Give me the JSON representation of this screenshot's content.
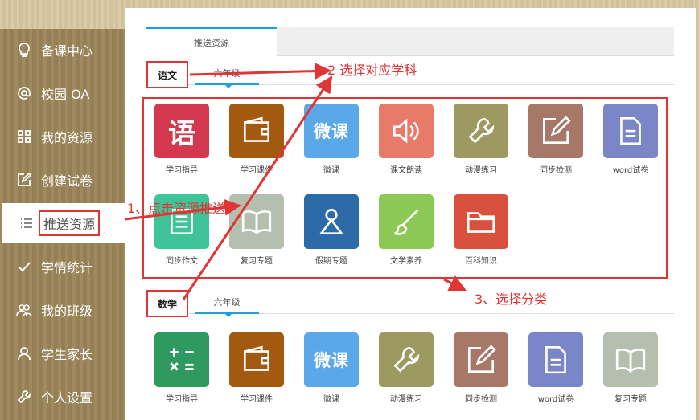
{
  "sidebar": {
    "items": [
      {
        "label": "备课中心",
        "icon": "lightbulb-icon"
      },
      {
        "label": "校园 OA",
        "icon": "at-icon"
      },
      {
        "label": "我的资源",
        "icon": "grid-icon"
      },
      {
        "label": "创建试卷",
        "icon": "edit-square-icon"
      },
      {
        "label": "推送资源",
        "icon": "list-icon"
      },
      {
        "label": "学情统计",
        "icon": "check-icon"
      },
      {
        "label": "我的班级",
        "icon": "users-icon"
      },
      {
        "label": "学生家长",
        "icon": "user-icon"
      },
      {
        "label": "个人设置",
        "icon": "wrench-icon"
      }
    ]
  },
  "main": {
    "tab_label": "推送资源",
    "sections": [
      {
        "subject": "语文",
        "grade": "六年级",
        "resources": [
          {
            "label": "学习指导",
            "icon": "yu-char-icon",
            "color": "#d4384f"
          },
          {
            "label": "学习课件",
            "icon": "wallet-icon",
            "color": "#a3590f"
          },
          {
            "label": "微课",
            "icon": "weike-text-icon",
            "color": "#5aa8e8"
          },
          {
            "label": "课文朗读",
            "icon": "speaker-icon",
            "color": "#e87a6a"
          },
          {
            "label": "动漫练习",
            "icon": "wrench-icon",
            "color": "#9c9a60"
          },
          {
            "label": "同步检测",
            "icon": "edit-icon",
            "color": "#a77868"
          },
          {
            "label": "word试卷",
            "icon": "document-icon",
            "color": "#7a86c8"
          },
          {
            "label": "同步作文",
            "icon": "notepad-icon",
            "color": "#3fc49a"
          },
          {
            "label": "复习专题",
            "icon": "book-icon",
            "color": "#b4bfae"
          },
          {
            "label": "假期专题",
            "icon": "person-icon",
            "color": "#2d6aa8"
          },
          {
            "label": "文学素养",
            "icon": "brush-icon",
            "color": "#8bc855"
          },
          {
            "label": "百科知识",
            "icon": "folder-icon",
            "color": "#d8503e"
          }
        ]
      },
      {
        "subject": "数学",
        "grade": "六年级",
        "resources": [
          {
            "label": "学习指导",
            "icon": "math-symbols-icon",
            "color": "#2f9a5f"
          },
          {
            "label": "学习课件",
            "icon": "wallet-icon",
            "color": "#a3590f"
          },
          {
            "label": "微课",
            "icon": "weike-text-icon",
            "color": "#5aa8e8"
          },
          {
            "label": "动漫练习",
            "icon": "wrench-icon",
            "color": "#9c9a60"
          },
          {
            "label": "同步检测",
            "icon": "edit-icon",
            "color": "#a77868"
          },
          {
            "label": "word试卷",
            "icon": "document-icon",
            "color": "#7a86c8"
          },
          {
            "label": "复习专题",
            "icon": "book-icon",
            "color": "#b4bfae"
          }
        ]
      }
    ]
  },
  "tiles": {
    "yu_char": "语",
    "weike": "微课"
  },
  "annotations": {
    "step1": "1、点击资源推送",
    "step2": "2 选择对应学科",
    "step3": "3、选择分类"
  },
  "colors": {
    "annotation_red": "#e03535",
    "tab_accent": "#1aa0e0",
    "sidebar_bg": "#9b8458"
  }
}
